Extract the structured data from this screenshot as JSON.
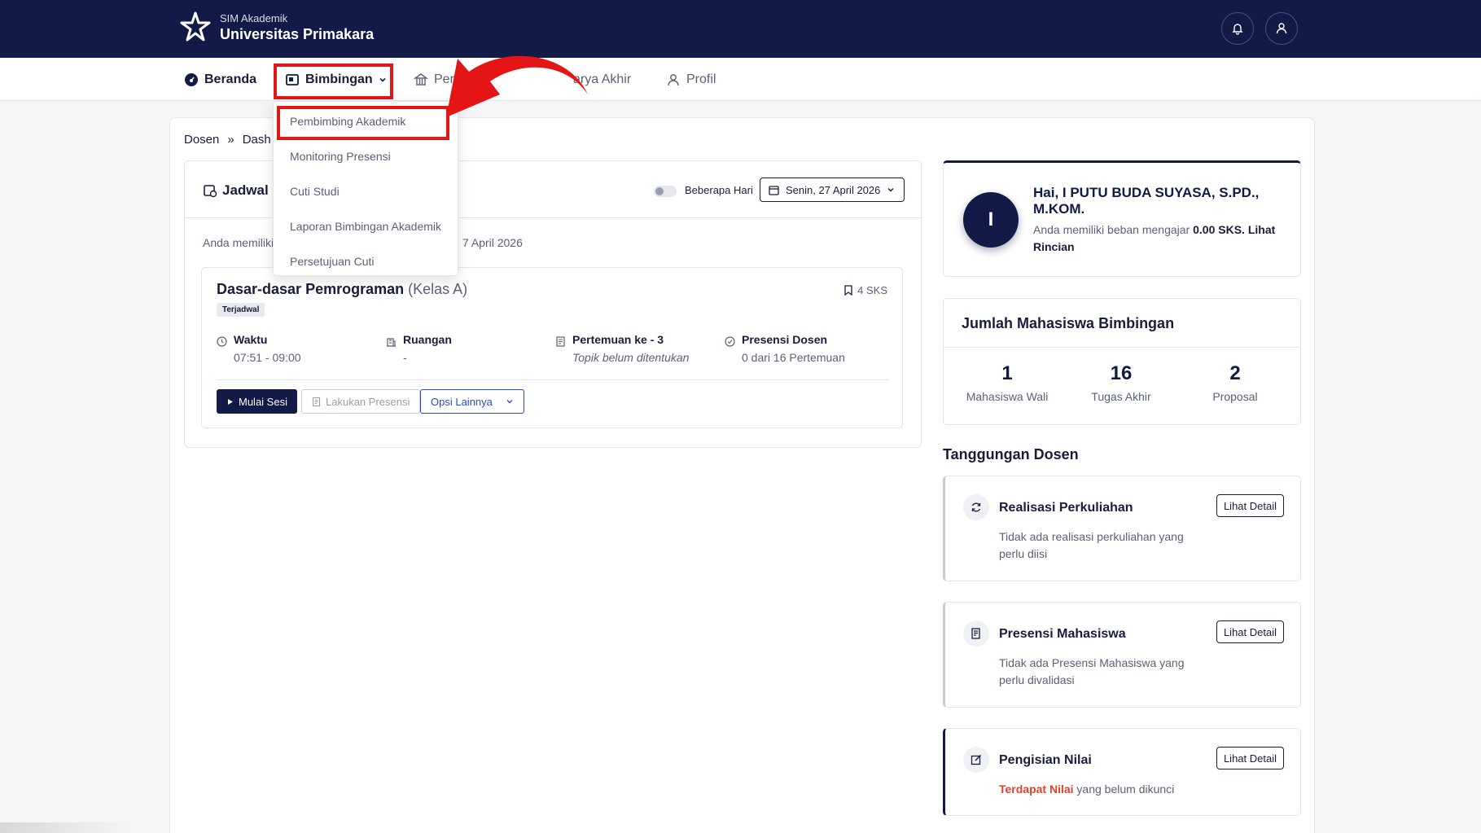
{
  "header": {
    "brand_sub": "SIM Akademik",
    "brand_name": "Universitas Primakara"
  },
  "nav": {
    "items": [
      {
        "label": "Beranda",
        "icon": "dashboard-icon"
      },
      {
        "label": "Bimbingan",
        "icon": "book-icon"
      },
      {
        "label": "Perkuli",
        "icon": "bank-icon"
      },
      {
        "label": "arya Akhir",
        "icon": "document-icon"
      },
      {
        "label": "Profil",
        "icon": "user-icon"
      }
    ]
  },
  "dropdown": {
    "items": [
      "Pembimbing Akademik",
      "Monitoring Presensi",
      "Cuti Studi",
      "Laporan Bimbingan Akademik",
      "Persetujuan Cuti"
    ]
  },
  "breadcrumb": {
    "root": "Dosen",
    "sep": "»",
    "current": "Dash"
  },
  "schedule": {
    "title": "Jadwal M",
    "toggle_label": "Beberapa Hari",
    "date": "Senin, 27 April 2026",
    "info_start": "Anda memiliki",
    "info_end": "7 April 2026",
    "course": {
      "name": "Dasar-dasar Pemrograman",
      "kelas": "(Kelas A)",
      "badge": "Terjadwal",
      "sks": "4 SKS",
      "waktu_label": "Waktu",
      "waktu_value": "07:51 - 09:00",
      "ruangan_label": "Ruangan",
      "ruangan_value": "-",
      "pertemuan_label": "Pertemuan ke - 3",
      "pertemuan_value": "Topik belum ditentukan",
      "presensi_label": "Presensi Dosen",
      "presensi_value": "0 dari 16 Pertemuan"
    },
    "buttons": {
      "mulai": "Mulai Sesi",
      "presensi": "Lakukan Presensi",
      "opsi": "Opsi Lainnya"
    }
  },
  "profile": {
    "initial": "I",
    "greeting": "Hai, I PUTU BUDA SUYASA, S.PD., M.KOM.",
    "sub_prefix": "Anda memiliki beban mengajar",
    "sks": "0.00 SKS.",
    "link": "Lihat Rincian"
  },
  "mahasiswa": {
    "title": "Jumlah Mahasiswa Bimbingan",
    "stats": [
      {
        "value": "1",
        "label": "Mahasiswa Wali"
      },
      {
        "value": "16",
        "label": "Tugas Akhir"
      },
      {
        "value": "2",
        "label": "Proposal"
      }
    ]
  },
  "tanggungan": {
    "title": "Tanggungan Dosen",
    "button_label": "Lihat Detail",
    "items": [
      {
        "title": "Realisasi Perkuliahan",
        "desc": "Tidak ada realisasi perkuliahan yang perlu diisi"
      },
      {
        "title": "Presensi Mahasiswa",
        "desc": "Tidak ada Presensi Mahasiswa yang perlu divalidasi"
      },
      {
        "title": "Pengisian Nilai",
        "desc_red": "Terdapat Nilai",
        "desc": " yang belum dikunci"
      }
    ]
  },
  "colors": {
    "navy": "#121a47",
    "highlight_red": "#e01818",
    "link_blue": "#2a49d3"
  }
}
